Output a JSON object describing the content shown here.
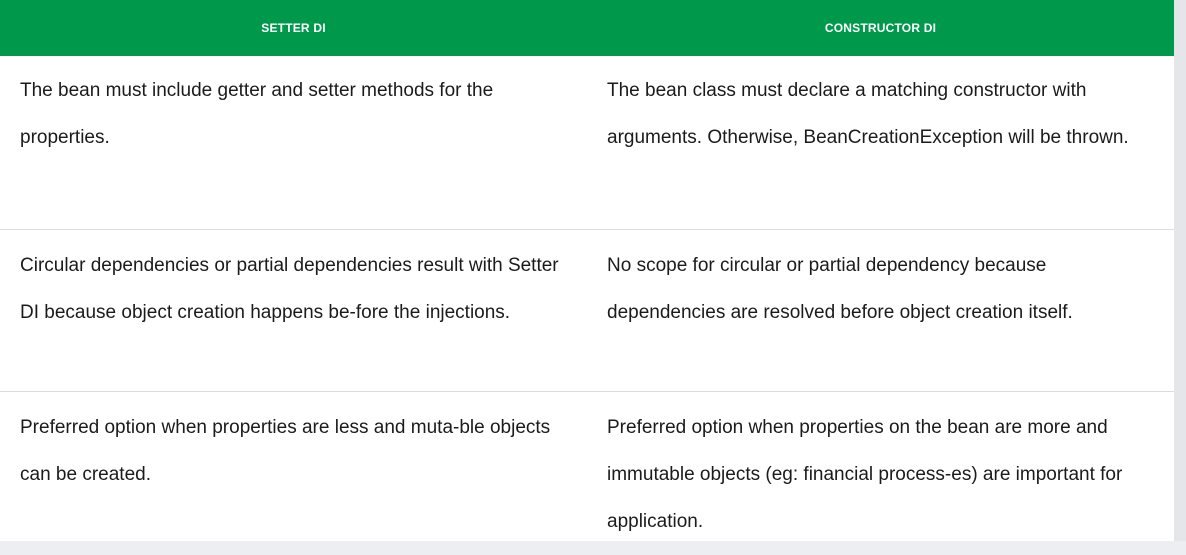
{
  "table": {
    "headers": [
      "SETTER DI",
      "CONSTRUCTOR DI"
    ],
    "rows": [
      {
        "setter": "The bean must include getter and setter methods for the properties.",
        "constructor": "The bean class must declare a matching constructor with arguments. Otherwise, BeanCreationException will be thrown."
      },
      {
        "setter": "Circular dependencies or partial dependencies result with Setter DI because object creation happens be-fore the injections.",
        "constructor": "No scope for circular or partial dependency because dependencies are resolved before object creation itself."
      },
      {
        "setter": "Preferred option when properties are less and muta-ble objects can be created.",
        "constructor": "Preferred option when properties on the bean are more and immutable objects (eg: financial process-es) are important for application."
      }
    ]
  },
  "colors": {
    "header_bg": "#00994c",
    "header_text": "#ffffff",
    "row_divider": "#dcdde0",
    "body_text": "#1b1b1b"
  }
}
